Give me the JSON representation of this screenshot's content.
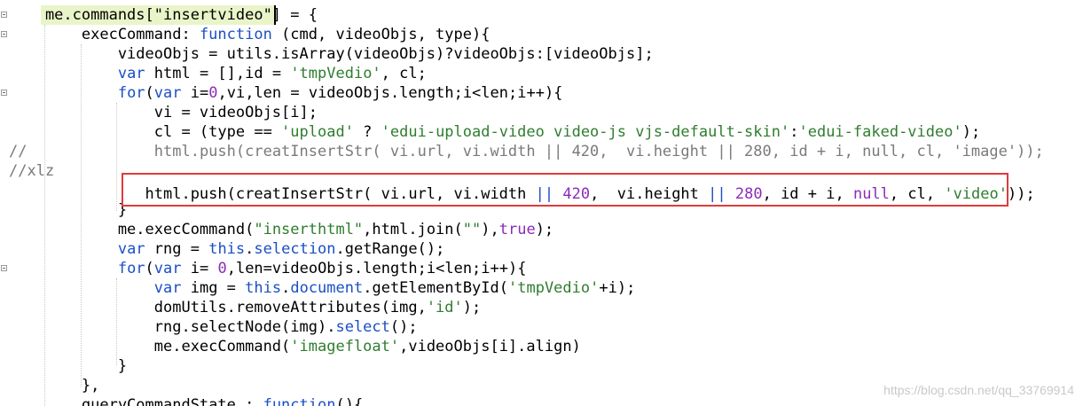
{
  "lines": [
    [
      {
        "t": "    me.commands[\"insertvideo\"] = {"
      }
    ],
    [
      {
        "t": "        execCommand: "
      },
      {
        "t": "function",
        "c": "kw"
      },
      {
        "t": " (cmd, videoObjs, type){"
      }
    ],
    [
      {
        "t": "            videoObjs = utils.isArray(videoObjs)?videoObjs:[videoObjs];"
      }
    ],
    [
      {
        "t": "            "
      },
      {
        "t": "var",
        "c": "kw"
      },
      {
        "t": " html = [],id = "
      },
      {
        "t": "'tmpVedio'",
        "c": "str"
      },
      {
        "t": ", cl;"
      }
    ],
    [
      {
        "t": "            "
      },
      {
        "t": "for",
        "c": "kw"
      },
      {
        "t": "("
      },
      {
        "t": "var",
        "c": "kw"
      },
      {
        "t": " i="
      },
      {
        "t": "0",
        "c": "num"
      },
      {
        "t": ",vi,len = videoObjs.length;i<len;i++){"
      }
    ],
    [
      {
        "t": "                vi = videoObjs[i];"
      }
    ],
    [
      {
        "t": "                cl = (type == "
      },
      {
        "t": "'upload'",
        "c": "str"
      },
      {
        "t": " ? "
      },
      {
        "t": "'edui-upload-video video-js vjs-default-skin'",
        "c": "str"
      },
      {
        "t": ":"
      },
      {
        "t": "'edui-faked-video'",
        "c": "str"
      },
      {
        "t": ");"
      }
    ],
    [
      {
        "t": "//",
        "c": "cmt"
      },
      {
        "t": "              html.push(creatInsertStr( vi.url, vi.width || 420,  vi.height || 280, id + i, null, cl, 'image'));",
        "c": "cmt"
      }
    ],
    [
      {
        "t": "//xlz",
        "c": "cmt"
      }
    ],
    [
      {
        "t": "               html.push(creatInsertStr( vi.url, vi.width "
      },
      {
        "t": "||",
        "c": "kw"
      },
      {
        "t": " "
      },
      {
        "t": "420",
        "c": "num"
      },
      {
        "t": ",  vi.height "
      },
      {
        "t": "||",
        "c": "kw"
      },
      {
        "t": " "
      },
      {
        "t": "280",
        "c": "num"
      },
      {
        "t": ", id + i, "
      },
      {
        "t": "null",
        "c": "num"
      },
      {
        "t": ", cl, "
      },
      {
        "t": "'video'",
        "c": "str"
      },
      {
        "t": "));"
      }
    ],
    [
      {
        "t": "            }"
      }
    ],
    [
      {
        "t": "            me.execCommand("
      },
      {
        "t": "\"inserthtml\"",
        "c": "str"
      },
      {
        "t": ",html.join("
      },
      {
        "t": "\"\"",
        "c": "str"
      },
      {
        "t": "),"
      },
      {
        "t": "true",
        "c": "num"
      },
      {
        "t": ");"
      }
    ],
    [
      {
        "t": "            "
      },
      {
        "t": "var",
        "c": "kw"
      },
      {
        "t": " rng = "
      },
      {
        "t": "this",
        "c": "kw"
      },
      {
        "t": "."
      },
      {
        "t": "selection",
        "c": "kw"
      },
      {
        "t": ".getRange();"
      }
    ],
    [
      {
        "t": "            "
      },
      {
        "t": "for",
        "c": "kw"
      },
      {
        "t": "("
      },
      {
        "t": "var",
        "c": "kw"
      },
      {
        "t": " i= "
      },
      {
        "t": "0",
        "c": "num"
      },
      {
        "t": ",len=videoObjs.length;i<len;i++){"
      }
    ],
    [
      {
        "t": "                "
      },
      {
        "t": "var",
        "c": "kw"
      },
      {
        "t": " img = "
      },
      {
        "t": "this",
        "c": "kw"
      },
      {
        "t": "."
      },
      {
        "t": "document",
        "c": "kw"
      },
      {
        "t": ".getElementById("
      },
      {
        "t": "'tmpVedio'",
        "c": "str"
      },
      {
        "t": "+i);"
      }
    ],
    [
      {
        "t": "                domUtils.removeAttributes(img,"
      },
      {
        "t": "'id'",
        "c": "str"
      },
      {
        "t": ");"
      }
    ],
    [
      {
        "t": "                rng.selectNode(img)."
      },
      {
        "t": "select",
        "c": "kw"
      },
      {
        "t": "();"
      }
    ],
    [
      {
        "t": "                me.execCommand("
      },
      {
        "t": "'imagefloat'",
        "c": "str"
      },
      {
        "t": ",videoObjs[i].align)"
      }
    ],
    [
      {
        "t": "            }"
      }
    ],
    [
      {
        "t": "        },"
      }
    ],
    [
      {
        "t": "        queryCommandState : "
      },
      {
        "t": "function",
        "c": "kw"
      },
      {
        "t": "(){"
      }
    ]
  ],
  "colors": {
    "keyword": "#1a4fc4",
    "string": "#2f7d2f",
    "number": "#8b2bb8",
    "comment": "#7a7a7a",
    "current_line": "#e9f5c9",
    "selection_box": "#e03a3a"
  },
  "watermark": "https://blog.csdn.net/qq_33769914"
}
